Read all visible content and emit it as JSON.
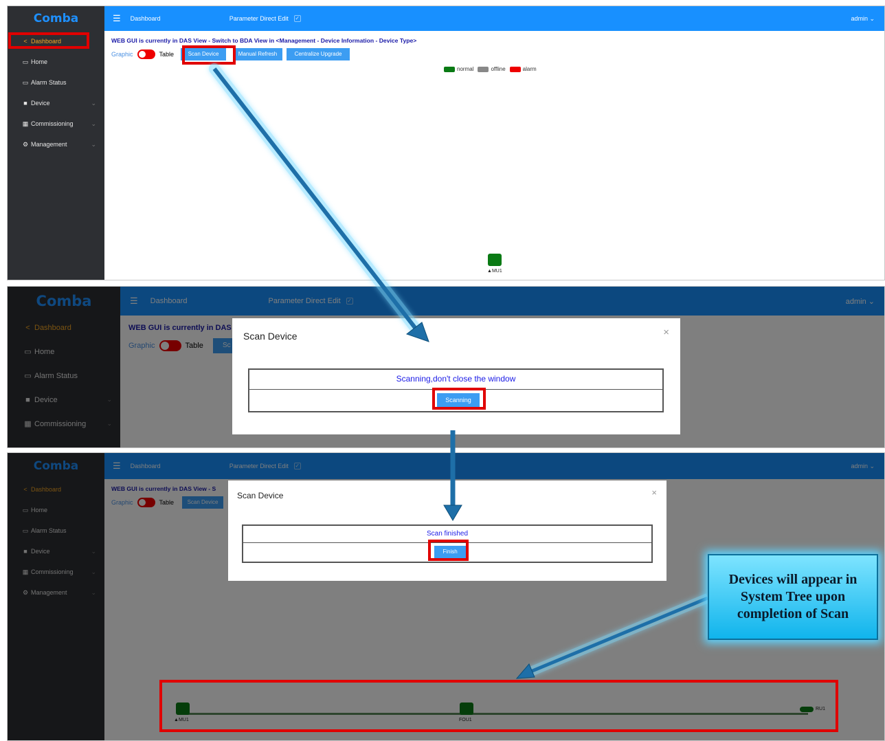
{
  "app": {
    "logo": "Comba",
    "header_title": "Dashboard",
    "param_edit": "Parameter Direct Edit",
    "user": "admin"
  },
  "sidebar": {
    "items": [
      {
        "label": "Dashboard",
        "icon": "share-icon"
      },
      {
        "label": "Home",
        "icon": "monitor-icon"
      },
      {
        "label": "Alarm Status",
        "icon": "alarm-monitor-icon"
      },
      {
        "label": "Device",
        "icon": "device-icon"
      },
      {
        "label": "Commissioning",
        "icon": "grid-icon"
      },
      {
        "label": "Management",
        "icon": "gear-icon"
      }
    ]
  },
  "main": {
    "notice_full": "WEB GUI is currently in DAS View - Switch to BDA View in <Management - Device Information - Device Type>",
    "notice_short_2": "WEB GUI is currently in DAS",
    "notice_short_3": "WEB GUI is currently in DAS View - S",
    "graphic_label": "Graphic",
    "table_label": "Table",
    "scan_button": "Scan Device",
    "scan_button_clipped": "Sc",
    "refresh_button": "Manual Refresh",
    "upgrade_button": "Centralize Upgrade"
  },
  "legend": {
    "items": [
      {
        "label": "normal",
        "color": "#0a7a14"
      },
      {
        "label": "offline",
        "color": "#888888"
      },
      {
        "label": "alarm",
        "color": "#e00000"
      }
    ]
  },
  "topology": {
    "mu": "MU1",
    "fou": "FOU1",
    "ru": "RU1"
  },
  "scan_modal": {
    "title": "Scan Device",
    "close": "×",
    "scanning_text": "Scanning,don't close the window",
    "scanning_button": "Scanning",
    "finished_text": "Scan finished",
    "finish_button": "Finish"
  },
  "callout": {
    "text": "Devices will appear in System Tree upon completion of Scan"
  },
  "colors": {
    "accent": "#1890ff",
    "sidebar": "#2d2f33",
    "active": "#f5a623",
    "highlight": "#e00000",
    "arrow": "#1e6fa8"
  }
}
